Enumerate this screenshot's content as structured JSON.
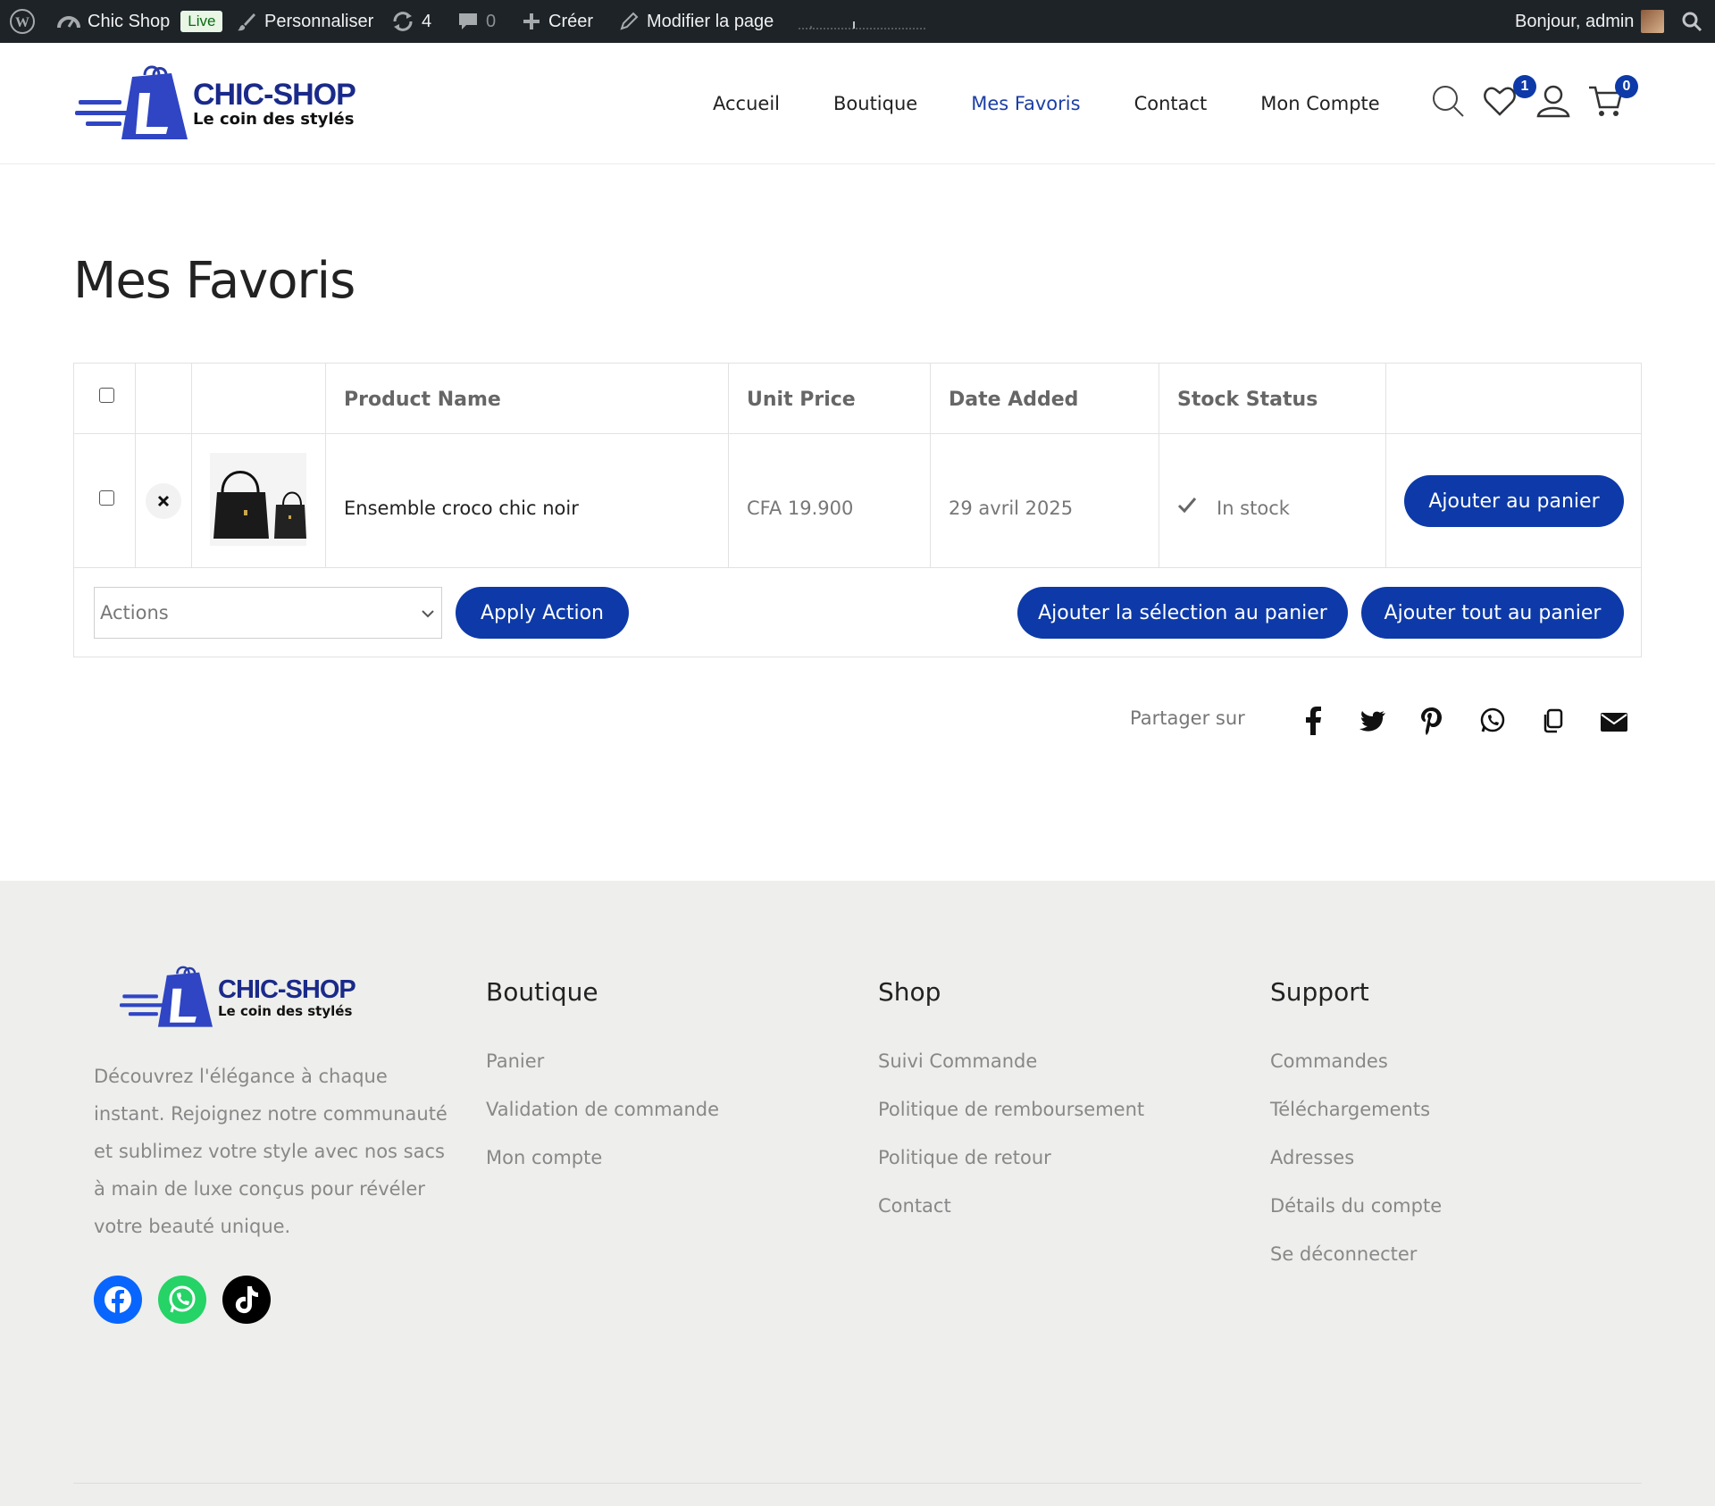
{
  "admin_bar": {
    "site_name": "Chic Shop",
    "live_badge": "Live",
    "customize": "Personnaliser",
    "updates_count": "4",
    "comments_count": "0",
    "new_label": "Créer",
    "edit_page": "Modifier la page",
    "greeting": "Bonjour, admin"
  },
  "logo": {
    "title_a": "CHIC-",
    "title_b": "SHOP",
    "tagline": "Le coin des stylés"
  },
  "nav": {
    "items": [
      "Accueil",
      "Boutique",
      "Mes Favoris",
      "Contact",
      "Mon Compte"
    ],
    "active": "Mes Favoris",
    "wishlist_count": "1",
    "cart_count": "0"
  },
  "page": {
    "title": "Mes Favoris"
  },
  "wishlist": {
    "headers": {
      "name": "Product Name",
      "price": "Unit Price",
      "date": "Date Added",
      "stock": "Stock Status"
    },
    "rows": [
      {
        "name": "Ensemble croco chic noir",
        "price": "CFA 19.900",
        "date": "29 avril 2025",
        "stock": "In stock",
        "button": "Ajouter au panier"
      }
    ],
    "actions_select": "Actions",
    "apply_button": "Apply Action",
    "add_selected": "Ajouter la sélection au panier",
    "add_all": "Ajouter tout au panier"
  },
  "share": {
    "label": "Partager sur",
    "icons": [
      "facebook-icon",
      "twitter-icon",
      "pinterest-icon",
      "whatsapp-icon",
      "copy-link-icon",
      "email-icon"
    ]
  },
  "footer": {
    "description": "Découvrez l'élégance à chaque instant. Rejoignez notre communauté et sublimez votre style avec nos sacs à main de luxe conçus pour révéler votre beauté unique.",
    "columns": [
      {
        "title": "Boutique",
        "links": [
          "Panier",
          "Validation de commande",
          "Mon compte"
        ]
      },
      {
        "title": "Shop",
        "links": [
          "Suivi Commande",
          "Politique de remboursement",
          "Politique de retour",
          "Contact"
        ]
      },
      {
        "title": "Support",
        "links": [
          "Commandes",
          "Téléchargements",
          "Adresses",
          "Détails du compte",
          "Se déconnecter"
        ]
      }
    ],
    "social": [
      "facebook-icon",
      "whatsapp-icon",
      "tiktok-icon"
    ]
  },
  "colors": {
    "accent": "#0d3aa8",
    "admin_bar": "#1d2327",
    "footer_bg": "#eeeeec",
    "whatsapp": "#25d366",
    "facebook": "#0866ff"
  }
}
